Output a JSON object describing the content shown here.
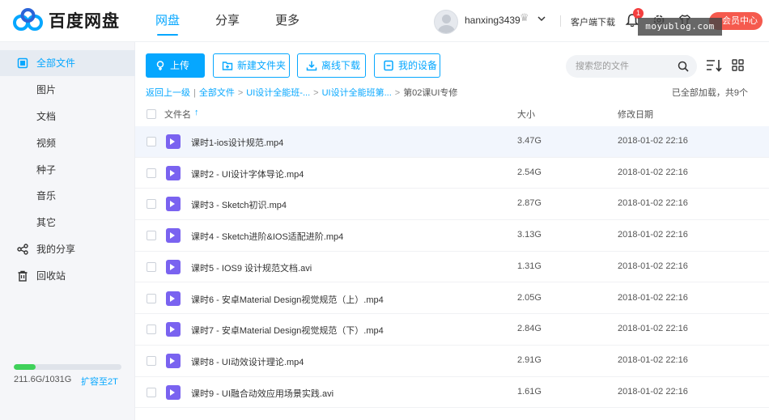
{
  "brand": {
    "name": "百度网盘"
  },
  "topnav": [
    {
      "label": "网盘",
      "active": true
    },
    {
      "label": "分享",
      "active": false
    },
    {
      "label": "更多",
      "active": false
    }
  ],
  "user": {
    "name": "hanxing3439",
    "client_download": "客户端下载",
    "notification_count": "1",
    "vip_center": "会员中心",
    "watermark": "moyublog.com"
  },
  "sidebar": {
    "items": [
      {
        "label": "全部文件",
        "icon": "folder-icon",
        "active": true
      },
      {
        "label": "图片",
        "icon": "",
        "active": false
      },
      {
        "label": "文档",
        "icon": "",
        "active": false
      },
      {
        "label": "视频",
        "icon": "",
        "active": false
      },
      {
        "label": "种子",
        "icon": "",
        "active": false
      },
      {
        "label": "音乐",
        "icon": "",
        "active": false
      },
      {
        "label": "其它",
        "icon": "",
        "active": false
      },
      {
        "label": "我的分享",
        "icon": "share-icon",
        "active": false
      },
      {
        "label": "回收站",
        "icon": "trash-icon",
        "active": false
      }
    ],
    "quota": {
      "used_text": "211.6G/1031G",
      "expand": "扩容至2T",
      "used_fraction": 0.205
    }
  },
  "toolbar": {
    "upload": "上传",
    "new_folder": "新建文件夹",
    "offline_download": "离线下载",
    "my_devices": "我的设备",
    "search_placeholder": "搜索您的文件"
  },
  "breadcrumb": {
    "back": "返回上一级",
    "items": [
      "全部文件",
      "UI设计全能班-...",
      "UI设计全能班第...",
      "第02课UI专修"
    ],
    "loaded_text": "已全部加载，共9个"
  },
  "table": {
    "headers": {
      "name": "文件名",
      "sort_arrow": "↑",
      "size": "大小",
      "date": "修改日期"
    },
    "rows": [
      {
        "name": "课时1-ios设计规范.mp4",
        "size": "3.47G",
        "date": "2018-01-02 22:16"
      },
      {
        "name": "课时2 - UI设计字体导论.mp4",
        "size": "2.54G",
        "date": "2018-01-02 22:16"
      },
      {
        "name": "课时3 - Sketch初识.mp4",
        "size": "2.87G",
        "date": "2018-01-02 22:16"
      },
      {
        "name": "课时4 - Sketch进阶&IOS适配进阶.mp4",
        "size": "3.13G",
        "date": "2018-01-02 22:16"
      },
      {
        "name": "课时5 - IOS9 设计规范文档.avi",
        "size": "1.31G",
        "date": "2018-01-02 22:16"
      },
      {
        "name": "课时6 - 安卓Material Design视觉规范（上）.mp4",
        "size": "2.05G",
        "date": "2018-01-02 22:16"
      },
      {
        "name": "课时7 - 安卓Material Design视觉规范（下）.mp4",
        "size": "2.84G",
        "date": "2018-01-02 22:16"
      },
      {
        "name": "课时8 - UI动效设计理论.mp4",
        "size": "2.91G",
        "date": "2018-01-02 22:16"
      },
      {
        "name": "课时9 - UI融合动效应用场景实践.avi",
        "size": "1.61G",
        "date": "2018-01-02 22:16"
      }
    ]
  },
  "colors": {
    "accent": "#06a7ff",
    "vip": "#f55a4e",
    "quota": "#3fd15a",
    "video_icon": "#7a63f0"
  }
}
